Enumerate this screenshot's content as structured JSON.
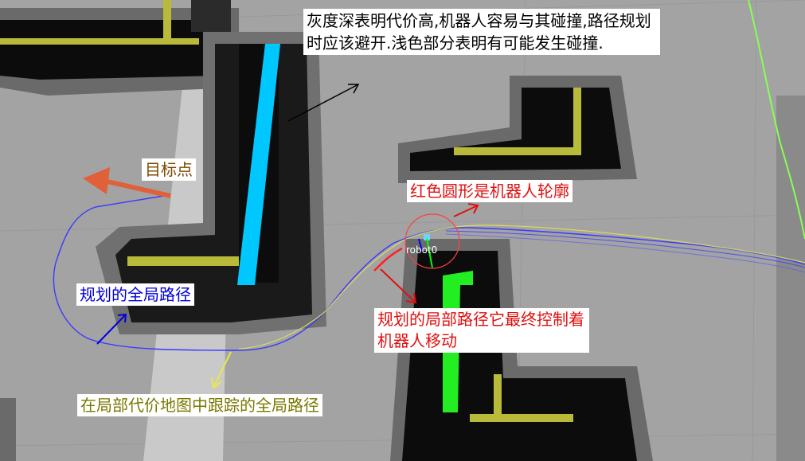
{
  "annotations": {
    "cost_note": "灰度深表明代价高,机器人容易与其碰撞,路径规划时应该避开.浅色部分表明有可能发生碰撞.",
    "goal": "目标点",
    "robot_circle": "红色圆形是机器人轮廓",
    "global_path": "规划的全局路径",
    "local_path": "规划的局部路径它最终控制着机器人移动",
    "tracked_global_path": "在局部代价地图中跟踪的全局路径"
  },
  "robot": {
    "name": "robot0"
  },
  "colors": {
    "background": "#a3a3a3",
    "inflation_light": "#c9c9c9",
    "inflation_dark": "#2b2b2b",
    "lethal": "#0c0c0c",
    "obstacle_yellow": "#b9b93a",
    "cyan_obstacle": "#00c8ff",
    "green_obstacle": "#22ee22",
    "global_path": "#3a3aff",
    "local_path": "#ff2020",
    "tracked_path": "#e8e84a",
    "far_path": "#88ff55",
    "goal_arrow": "#e0603a"
  }
}
